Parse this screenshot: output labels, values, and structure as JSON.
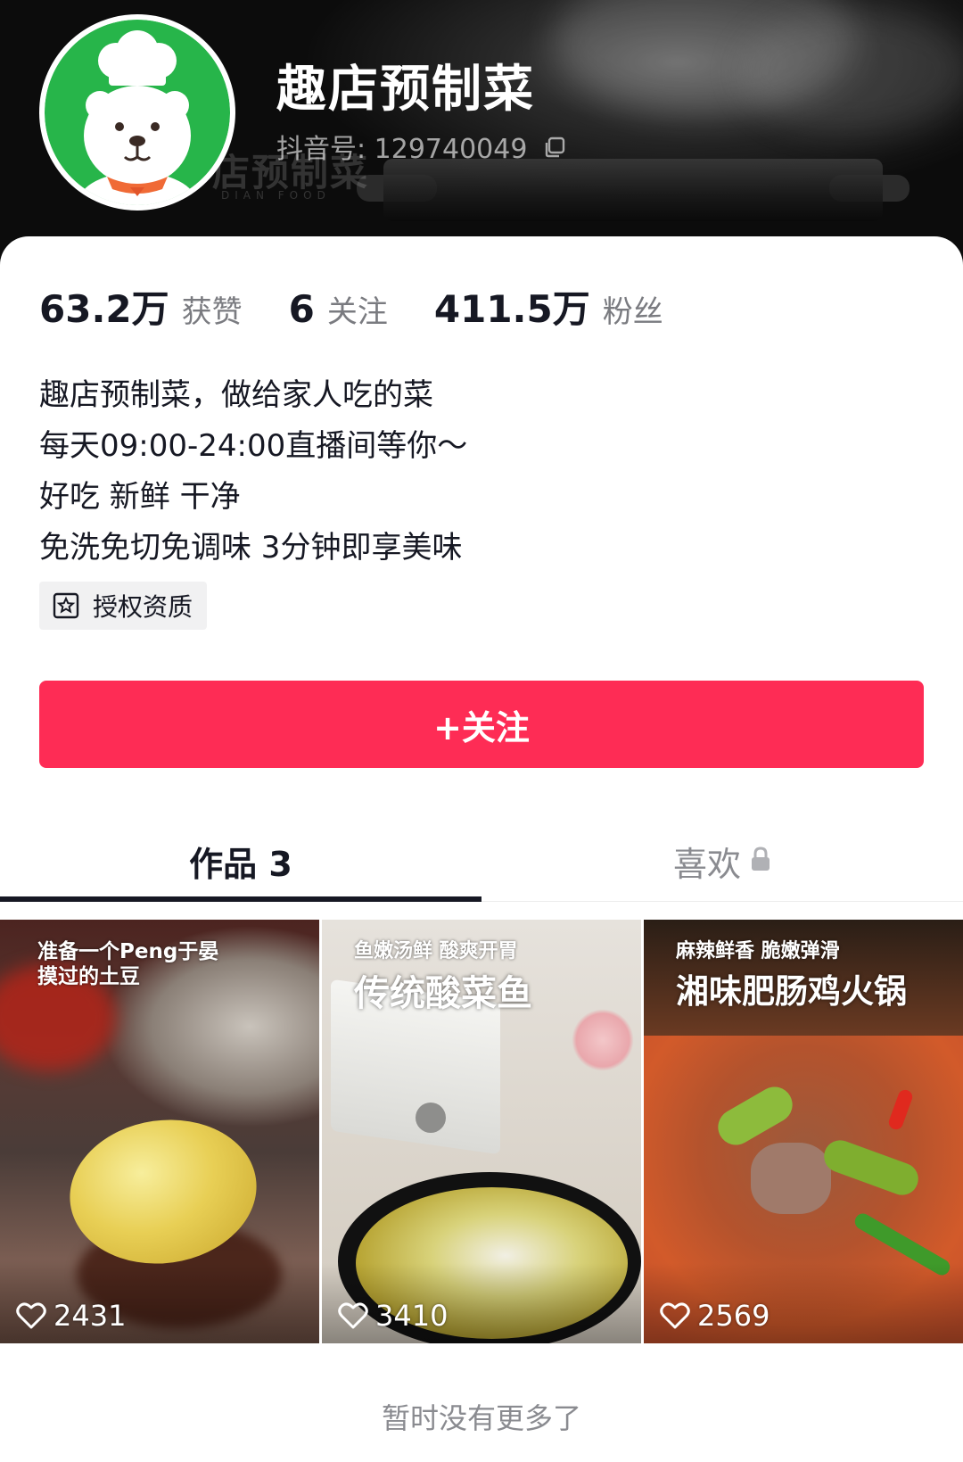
{
  "profile": {
    "name": "趣店预制菜",
    "douyin_id": "抖音号: 129740049",
    "banner_watermark": "店预制菜",
    "banner_watermark_sub": "DIAN FOOD"
  },
  "stats": [
    {
      "value": "63.2万",
      "label": "获赞"
    },
    {
      "value": "6",
      "label": "关注"
    },
    {
      "value": "411.5万",
      "label": "粉丝"
    }
  ],
  "bio": {
    "lines": [
      "趣店预制菜，做给家人吃的菜",
      "每天09:00-24:00直播间等你～",
      "好吃 新鲜 干净",
      "免洗免切免调味 3分钟即享美味"
    ]
  },
  "certification": {
    "label": "授权资质",
    "icon": "certificate-star-icon"
  },
  "follow_button": {
    "label": "+关注"
  },
  "tabs": [
    {
      "label": "作品 3",
      "active": true
    },
    {
      "label": "喜欢",
      "active": false,
      "icon": "lock-icon"
    }
  ],
  "videos": [
    {
      "caption_small": "准备一个Peng于晏\n摸过的土豆",
      "caption_big": "",
      "likes": "2431"
    },
    {
      "caption_small": "鱼嫩汤鲜 酸爽开胃",
      "caption_big": "传统酸菜鱼",
      "likes": "3410"
    },
    {
      "caption_small": "麻辣鲜香 脆嫩弹滑",
      "caption_big": "湘味肥肠鸡火锅",
      "likes": "2569"
    }
  ],
  "footer": {
    "no_more": "暂时没有更多了"
  },
  "colors": {
    "accent": "#fe2c55",
    "avatar_green": "#27b54a",
    "text": "#161823",
    "muted": "#7a7b80"
  }
}
